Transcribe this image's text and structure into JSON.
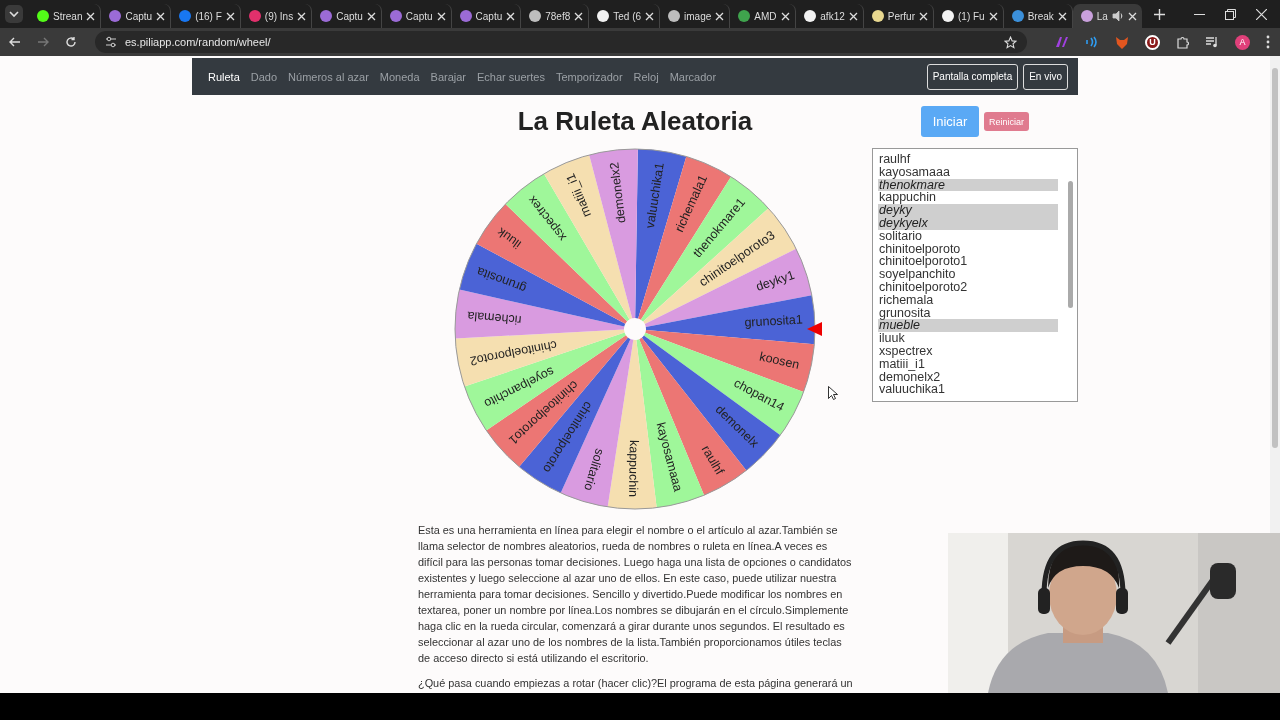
{
  "browser": {
    "tabs": [
      {
        "title": "Strean",
        "color": "#53fc18",
        "selected": false
      },
      {
        "title": "Captu",
        "color": "#9b6bd6",
        "selected": false
      },
      {
        "title": "(16) F",
        "color": "#1877f2",
        "selected": false
      },
      {
        "title": "(9) Ins",
        "color": "#e1306c",
        "selected": false
      },
      {
        "title": "Captu",
        "color": "#9b6bd6",
        "selected": false
      },
      {
        "title": "Captu",
        "color": "#9b6bd6",
        "selected": false
      },
      {
        "title": "Captu",
        "color": "#9b6bd6",
        "selected": false
      },
      {
        "title": "78ef8",
        "color": "#bdbdbd",
        "selected": false
      },
      {
        "title": "Ted (6",
        "color": "#f2f2f2",
        "selected": false
      },
      {
        "title": "image",
        "color": "#bdbdbd",
        "selected": false
      },
      {
        "title": "AMD",
        "color": "#3fa34d",
        "selected": false
      },
      {
        "title": "afk12",
        "color": "#f2f2f2",
        "selected": false
      },
      {
        "title": "Perfur",
        "color": "#e8d890",
        "selected": false
      },
      {
        "title": "(1) Fu",
        "color": "#f2f2f2",
        "selected": false
      },
      {
        "title": "Break",
        "color": "#3b8fd9",
        "selected": false
      },
      {
        "title": "La",
        "color": "#c9a0dc",
        "selected": true
      }
    ],
    "address": "es.piliapp.com/random/wheel/",
    "extension_badge": "U",
    "profile_initial": "A"
  },
  "nav": {
    "items": [
      {
        "label": "Ruleta",
        "selected": true
      },
      {
        "label": "Dado",
        "selected": false
      },
      {
        "label": "Números al azar",
        "selected": false
      },
      {
        "label": "Moneda",
        "selected": false
      },
      {
        "label": "Barajar",
        "selected": false
      },
      {
        "label": "Echar suertes",
        "selected": false
      },
      {
        "label": "Temporizador",
        "selected": false
      },
      {
        "label": "Reloj",
        "selected": false
      },
      {
        "label": "Marcador",
        "selected": false
      }
    ],
    "buttons": [
      "Pantalla completa",
      "En vivo"
    ]
  },
  "title": "La Ruleta Aleatoria",
  "start_button": "Iniciar",
  "reset_button": "Reiniciar",
  "wheel": {
    "segments": [
      {
        "label": "valuuchika1",
        "color": "#4b63d6"
      },
      {
        "label": "richemala1",
        "color": "#ec7674"
      },
      {
        "label": "thenokmare1",
        "color": "#9ff79a"
      },
      {
        "label": "chinitoelporoto3",
        "color": "#f5dfb0"
      },
      {
        "label": "deyky1",
        "color": "#d99be0"
      },
      {
        "label": "grunosita1",
        "color": "#4b63d6"
      },
      {
        "label": "koosen",
        "color": "#ec7674"
      },
      {
        "label": "chopan14",
        "color": "#9ff79a"
      },
      {
        "label": "demonelx",
        "color": "#4b63d6"
      },
      {
        "label": "raulhf",
        "color": "#ec7674"
      },
      {
        "label": "kayosamaaa",
        "color": "#9ff79a"
      },
      {
        "label": "kappuchin",
        "color": "#f5dfb0"
      },
      {
        "label": "solitario",
        "color": "#d99be0"
      },
      {
        "label": "chinitoelporoto",
        "color": "#4b63d6"
      },
      {
        "label": "chinitoelporoto1",
        "color": "#ec7674"
      },
      {
        "label": "soyelpanchito",
        "color": "#9ff79a"
      },
      {
        "label": "chinitoelporoto2",
        "color": "#f5dfb0"
      },
      {
        "label": "richemala",
        "color": "#d99be0"
      },
      {
        "label": "grunosita",
        "color": "#4b63d6"
      },
      {
        "label": "iluuk",
        "color": "#ec7674"
      },
      {
        "label": "xspectrex",
        "color": "#9ff79a"
      },
      {
        "label": "matiii_i1",
        "color": "#f5dfb0"
      },
      {
        "label": "demonelx2",
        "color": "#d99be0"
      }
    ]
  },
  "names_list": [
    {
      "name": "raulhf",
      "excluded": false
    },
    {
      "name": "kayosamaaa",
      "excluded": false
    },
    {
      "name": "thenokmare",
      "excluded": true
    },
    {
      "name": "kappuchin",
      "excluded": false
    },
    {
      "name": "deyky",
      "excluded": true
    },
    {
      "name": "deykyelx",
      "excluded": true
    },
    {
      "name": "solitario",
      "excluded": false
    },
    {
      "name": "chinitoelporoto",
      "excluded": false
    },
    {
      "name": "chinitoelporoto1",
      "excluded": false
    },
    {
      "name": "soyelpanchito",
      "excluded": false
    },
    {
      "name": "chinitoelporoto2",
      "excluded": false
    },
    {
      "name": "richemala",
      "excluded": false
    },
    {
      "name": "grunosita",
      "excluded": false
    },
    {
      "name": "mueble",
      "excluded": true
    },
    {
      "name": "iluuk",
      "excluded": false
    },
    {
      "name": "xspectrex",
      "excluded": false
    },
    {
      "name": "matiii_i1",
      "excluded": false
    },
    {
      "name": "demonelx2",
      "excluded": false
    },
    {
      "name": "valuuchika1",
      "excluded": false
    }
  ],
  "paragraphs": [
    "Esta es una herramienta en línea para elegir el nombre o el artículo al azar.También se llama selector de nombres aleatorios, rueda de nombres o ruleta en línea.A veces es difícil para las personas tomar decisiones. Luego haga una lista de opciones o candidatos existentes y luego seleccione al azar uno de ellos. En este caso, puede utilizar nuestra herramienta para tomar decisiones. Sencillo y divertido.Puede modificar los nombres en textarea, poner un nombre por línea.Los nombres se dibujarán en el círculo.Simplemente haga clic en la rueda circular, comenzará a girar durante unos segundos. El resultado es seleccionar al azar uno de los nombres de la lista.También proporcionamos útiles teclas de acceso directo si está utilizando el escritorio.",
    "¿Qué pasa cuando empiezas a rotar (hacer clic)?El programa de esta página generará un"
  ]
}
